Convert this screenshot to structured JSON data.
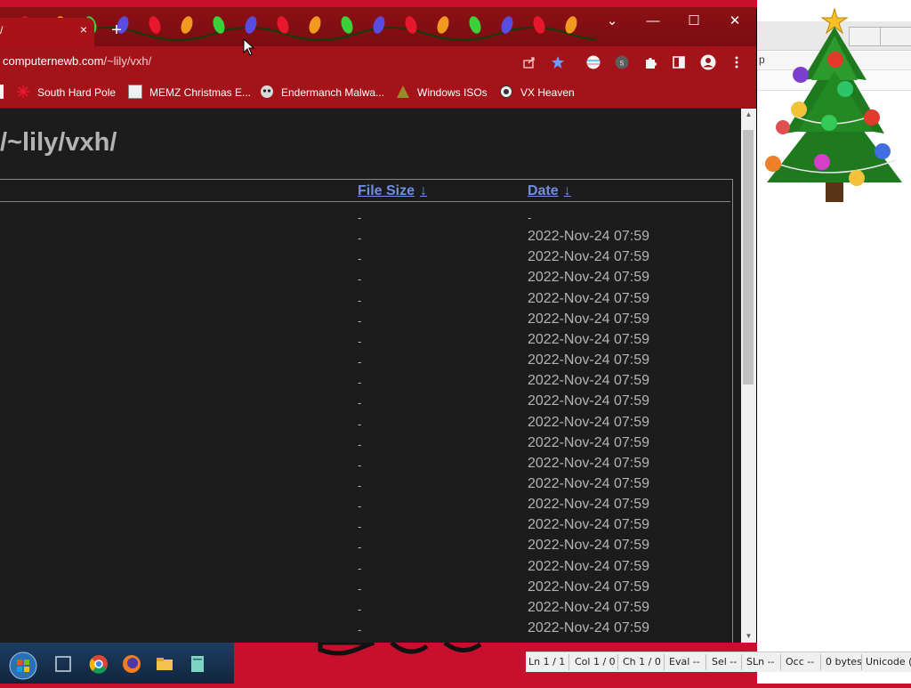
{
  "browser": {
    "tab": {
      "title": "/",
      "close_symbol": "×"
    },
    "new_tab_symbol": "+",
    "window_controls": {
      "dropdown": "⌄",
      "minimize": "—",
      "maximize": "☐",
      "close": "✕"
    },
    "address": {
      "host": "computernewb.com",
      "path": "/~lily/vxh/"
    },
    "bookmarks": [
      {
        "label": "South Hard Pole"
      },
      {
        "label": "MEMZ Christmas E..."
      },
      {
        "label": "Endermanch Malwa..."
      },
      {
        "label": "Windows ISOs"
      },
      {
        "label": "VX Heaven"
      }
    ],
    "profile_initial": "s"
  },
  "page": {
    "title": "/~lily/vxh/",
    "columns": {
      "size": "File Size",
      "date": "Date",
      "sort_arrow": "↓"
    },
    "rows": [
      {
        "size": "-",
        "date": "-"
      },
      {
        "size": "-",
        "date": "2022-Nov-24 07:59"
      },
      {
        "size": "-",
        "date": "2022-Nov-24 07:59"
      },
      {
        "size": "-",
        "date": "2022-Nov-24 07:59"
      },
      {
        "size": "-",
        "date": "2022-Nov-24 07:59"
      },
      {
        "size": "-",
        "date": "2022-Nov-24 07:59"
      },
      {
        "size": "-",
        "date": "2022-Nov-24 07:59"
      },
      {
        "size": "-",
        "date": "2022-Nov-24 07:59"
      },
      {
        "size": "-",
        "date": "2022-Nov-24 07:59"
      },
      {
        "size": "-",
        "date": "2022-Nov-24 07:59"
      },
      {
        "size": "-",
        "date": "2022-Nov-24 07:59"
      },
      {
        "size": "-",
        "date": "2022-Nov-24 07:59"
      },
      {
        "size": "-",
        "date": "2022-Nov-24 07:59"
      },
      {
        "size": "-",
        "date": "2022-Nov-24 07:59"
      },
      {
        "size": "-",
        "date": "2022-Nov-24 07:59"
      },
      {
        "size": "-",
        "date": "2022-Nov-24 07:59"
      },
      {
        "size": "-",
        "date": "2022-Nov-24 07:59"
      },
      {
        "size": "-",
        "date": "2022-Nov-24 07:59"
      },
      {
        "size": "-",
        "date": "2022-Nov-24 07:59"
      },
      {
        "size": "-",
        "date": "2022-Nov-24 07:59"
      },
      {
        "size": "-",
        "date": "2022-Nov-24 07:59"
      }
    ]
  },
  "right_window": {
    "menu_fragment": "p"
  },
  "statusbar": {
    "ln": "Ln 1 / 1",
    "col": "Col 1 / 0",
    "ch": "Ch 1 / 0",
    "eval": "Eval --",
    "sel": "Sel --",
    "sln": "SLn --",
    "occ": "Occ --",
    "bytes": "0 bytes",
    "encoding": "Unicode ("
  },
  "colors": {
    "tabbar": "#8c1015",
    "toolbar": "#a5131a",
    "page_bg": "#1c1c1c",
    "text": "#b3b3b3",
    "link": "#6f8fe0"
  }
}
